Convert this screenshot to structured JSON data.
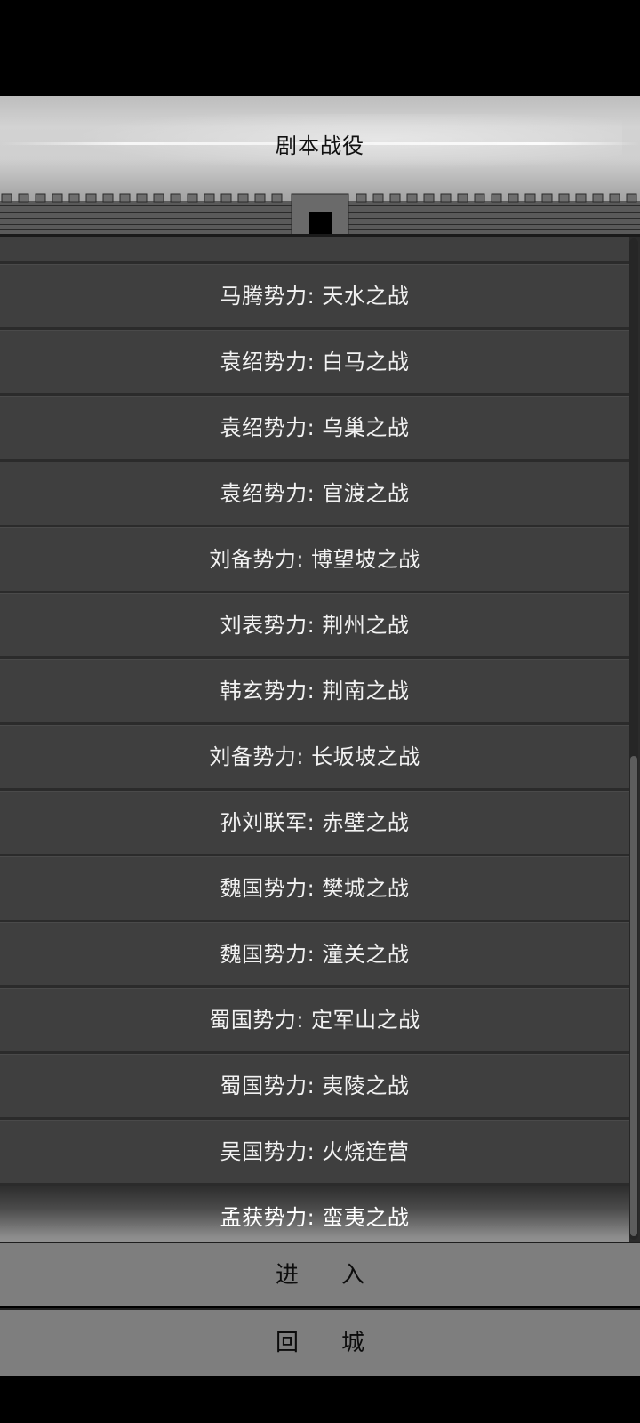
{
  "header": {
    "title": "剧本战役"
  },
  "campaigns": [
    "马腾势力: 天水之战",
    "袁绍势力: 白马之战",
    "袁绍势力: 乌巢之战",
    "袁绍势力: 官渡之战",
    "刘备势力: 博望坡之战",
    "刘表势力: 荆州之战",
    "韩玄势力: 荆南之战",
    "刘备势力: 长坂坡之战",
    "孙刘联军: 赤壁之战",
    "魏国势力: 樊城之战",
    "魏国势力: 潼关之战",
    "蜀国势力: 定军山之战",
    "蜀国势力: 夷陵之战",
    "吴国势力: 火烧连营",
    "孟获势力: 蛮夷之战"
  ],
  "selected_index": 14,
  "buttons": {
    "enter": "进入",
    "return": "回城"
  },
  "colors": {
    "item_bg": "#3f3f3f",
    "button_bg": "#7e7e7e",
    "item_text": "#f2f2f2"
  }
}
